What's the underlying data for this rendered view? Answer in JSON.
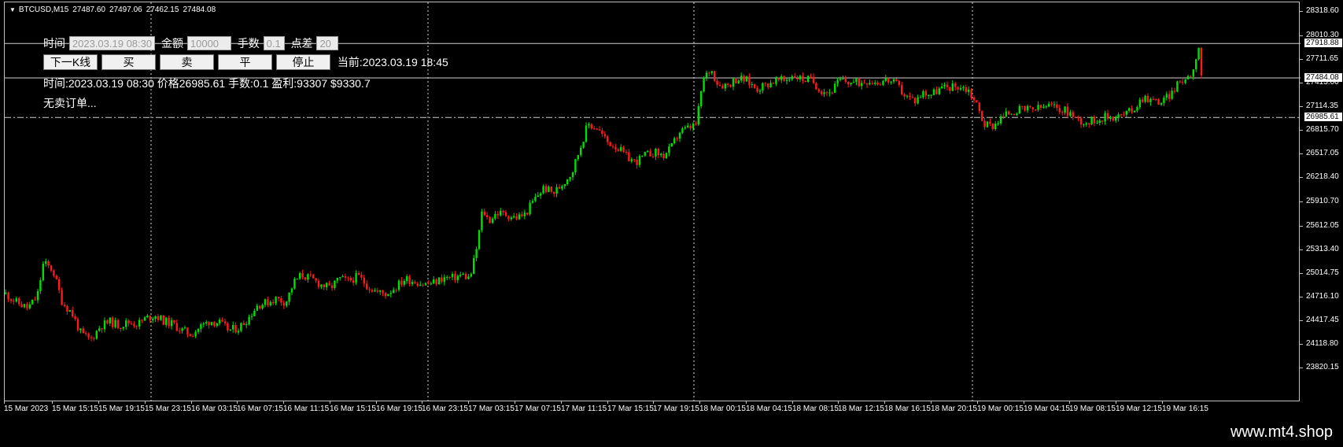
{
  "chart_header": {
    "symbol": "BTCUSD,M15",
    "open": "27487.60",
    "high": "27497.06",
    "low": "27462.15",
    "close": "27484.08"
  },
  "panel": {
    "time_label": "时间",
    "time_value": "2023.03.19 08:30",
    "amount_label": "金额",
    "amount_value": "10000",
    "lots_label": "手数",
    "lots_value": "0.1",
    "spread_label": "点差",
    "spread_value": "20",
    "buttons": [
      "下一K线",
      "买",
      "卖",
      "平",
      "停止"
    ],
    "current_text": "当前:2023.03.19 18:45",
    "order_text": "时间:2023.03.19 08:30 价格26985.61 手数:0.1 盈利:93307 $9330.7",
    "no_sell_text": "无卖订单..."
  },
  "price_scale": {
    "labels": [
      "28318.60",
      "28010.30",
      "27711.65",
      "27413.00",
      "27114.35",
      "26815.70",
      "26517.05",
      "26218.40",
      "25910.70",
      "25612.05",
      "25313.40",
      "25014.75",
      "24716.10",
      "24417.45",
      "24118.80",
      "23820.15"
    ],
    "tags": [
      {
        "value": "27918.88",
        "style": "white"
      },
      {
        "value": "27484.08",
        "style": "white"
      },
      {
        "value": "26985.61",
        "style": "white"
      }
    ]
  },
  "time_axis": {
    "labels": [
      "15 Mar 2023",
      "15 Mar 15:15",
      "15 Mar 19:15",
      "15 Mar 23:15",
      "16 Mar 03:15",
      "16 Mar 07:15",
      "16 Mar 11:15",
      "16 Mar 15:15",
      "16 Mar 19:15",
      "16 Mar 23:15",
      "17 Mar 03:15",
      "17 Mar 07:15",
      "17 Mar 11:15",
      "17 Mar 15:15",
      "17 Mar 19:15",
      "18 Mar 00:15",
      "18 Mar 04:15",
      "18 Mar 08:15",
      "18 Mar 12:15",
      "18 Mar 16:15",
      "18 Mar 20:15",
      "19 Mar 00:15",
      "19 Mar 04:15",
      "19 Mar 08:15",
      "19 Mar 12:15",
      "19 Mar 16:15"
    ]
  },
  "footer": {
    "site": "www.mt4.shop"
  },
  "chart_data": {
    "type": "candlestick",
    "symbol": "BTCUSD",
    "timeframe": "M15",
    "ylim": [
      23820.15,
      28318.6
    ],
    "colors": {
      "up": "#00e000",
      "down": "#ff1a1a",
      "background": "#000000",
      "axis": "#c0c0c0"
    },
    "horizontal_lines": [
      {
        "price": 27918.88,
        "style": "solid"
      },
      {
        "price": 27484.08,
        "style": "solid"
      },
      {
        "price": 26985.61,
        "style": "dashdot"
      }
    ],
    "period_separators": [
      "15 Mar 19:15",
      "16 Mar 23:15",
      "18 Mar 00:15",
      "19 Mar 00:15"
    ],
    "close_path": [
      [
        0,
        24760
      ],
      [
        14,
        24650
      ],
      [
        28,
        24580
      ],
      [
        40,
        24720
      ],
      [
        48,
        25150
      ],
      [
        60,
        25060
      ],
      [
        72,
        24650
      ],
      [
        84,
        24520
      ],
      [
        96,
        24250
      ],
      [
        108,
        24180
      ],
      [
        120,
        24350
      ],
      [
        132,
        24410
      ],
      [
        144,
        24360
      ],
      [
        156,
        24400
      ],
      [
        168,
        24380
      ],
      [
        178,
        24450
      ],
      [
        190,
        24490
      ],
      [
        200,
        24420
      ],
      [
        212,
        24380
      ],
      [
        224,
        24300
      ],
      [
        236,
        24250
      ],
      [
        248,
        24350
      ],
      [
        260,
        24420
      ],
      [
        272,
        24390
      ],
      [
        284,
        24300
      ],
      [
        296,
        24330
      ],
      [
        308,
        24450
      ],
      [
        320,
        24620
      ],
      [
        332,
        24650
      ],
      [
        344,
        24700
      ],
      [
        356,
        24650
      ],
      [
        366,
        24900
      ],
      [
        376,
        25000
      ],
      [
        388,
        24950
      ],
      [
        400,
        24880
      ],
      [
        412,
        24830
      ],
      [
        424,
        24950
      ],
      [
        436,
        24920
      ],
      [
        448,
        24980
      ],
      [
        460,
        24860
      ],
      [
        472,
        24780
      ],
      [
        484,
        24760
      ],
      [
        496,
        24850
      ],
      [
        508,
        24950
      ],
      [
        520,
        24920
      ],
      [
        532,
        24880
      ],
      [
        544,
        24900
      ],
      [
        556,
        24960
      ],
      [
        568,
        24960
      ],
      [
        580,
        25000
      ],
      [
        590,
        24950
      ],
      [
        598,
        25300
      ],
      [
        606,
        25820
      ],
      [
        614,
        25680
      ],
      [
        624,
        25780
      ],
      [
        636,
        25760
      ],
      [
        648,
        25720
      ],
      [
        660,
        25760
      ],
      [
        672,
        25950
      ],
      [
        684,
        26100
      ],
      [
        696,
        26030
      ],
      [
        708,
        26150
      ],
      [
        720,
        26300
      ],
      [
        730,
        26600
      ],
      [
        740,
        26900
      ],
      [
        752,
        26850
      ],
      [
        764,
        26680
      ],
      [
        776,
        26620
      ],
      [
        788,
        26500
      ],
      [
        800,
        26420
      ],
      [
        812,
        26500
      ],
      [
        824,
        26550
      ],
      [
        836,
        26500
      ],
      [
        846,
        26600
      ],
      [
        856,
        26800
      ],
      [
        868,
        26850
      ],
      [
        878,
        26900
      ],
      [
        886,
        27450
      ],
      [
        896,
        27600
      ],
      [
        906,
        27400
      ],
      [
        918,
        27400
      ],
      [
        930,
        27480
      ],
      [
        942,
        27450
      ],
      [
        954,
        27350
      ],
      [
        966,
        27400
      ],
      [
        978,
        27450
      ],
      [
        990,
        27450
      ],
      [
        1000,
        27520
      ],
      [
        1012,
        27470
      ],
      [
        1024,
        27460
      ],
      [
        1036,
        27330
      ],
      [
        1048,
        27300
      ],
      [
        1060,
        27450
      ],
      [
        1072,
        27430
      ],
      [
        1084,
        27420
      ],
      [
        1096,
        27460
      ],
      [
        1108,
        27430
      ],
      [
        1120,
        27460
      ],
      [
        1132,
        27400
      ],
      [
        1144,
        27250
      ],
      [
        1156,
        27200
      ],
      [
        1166,
        27300
      ],
      [
        1176,
        27280
      ],
      [
        1188,
        27350
      ],
      [
        1200,
        27370
      ],
      [
        1212,
        27380
      ],
      [
        1224,
        27330
      ],
      [
        1234,
        27150
      ],
      [
        1244,
        26900
      ],
      [
        1254,
        26880
      ],
      [
        1266,
        26990
      ],
      [
        1278,
        27060
      ],
      [
        1290,
        27080
      ],
      [
        1302,
        27080
      ],
      [
        1314,
        27100
      ],
      [
        1326,
        27130
      ],
      [
        1338,
        27100
      ],
      [
        1350,
        27060
      ],
      [
        1362,
        26960
      ],
      [
        1374,
        26920
      ],
      [
        1386,
        26960
      ],
      [
        1398,
        26990
      ],
      [
        1410,
        27000
      ],
      [
        1422,
        27020
      ],
      [
        1434,
        27100
      ],
      [
        1446,
        27250
      ],
      [
        1458,
        27200
      ],
      [
        1470,
        27180
      ],
      [
        1482,
        27300
      ],
      [
        1494,
        27450
      ],
      [
        1504,
        27510
      ],
      [
        1510,
        27600
      ],
      [
        1516,
        27930
      ],
      [
        1520,
        27484
      ]
    ]
  }
}
